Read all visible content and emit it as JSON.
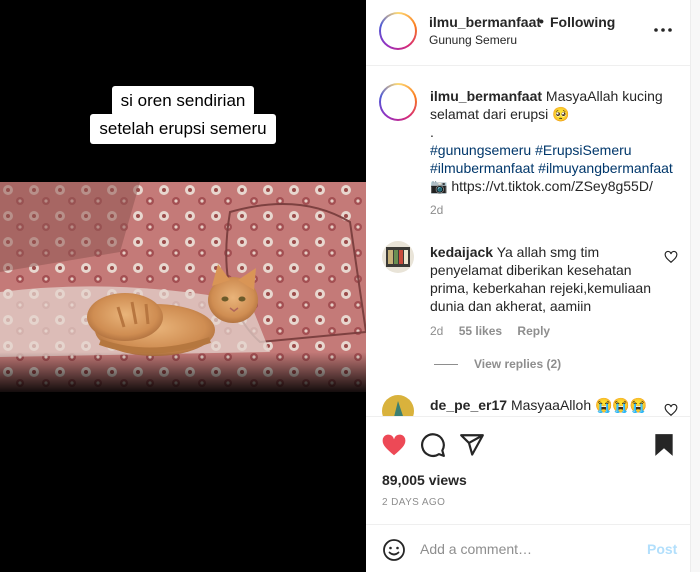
{
  "media": {
    "overlay_line1": "si oren sendirian",
    "overlay_line2": "setelah erupsi semeru"
  },
  "header": {
    "username": "ilmu_bermanfaat",
    "separator": "•",
    "follow_status": "Following",
    "location": "Gunung Semeru"
  },
  "caption": {
    "username": "ilmu_bermanfaat",
    "text": " MasyaAllah kucing selamat dari erupsi 🥺",
    "dot": ".",
    "hashtags": [
      "#gunungsemeru",
      "#ErupsiSemeru",
      "#ilmubermanfaat",
      "#ilmuyangbermanfaat"
    ],
    "link": "📷 https://vt.tiktok.com/ZSey8g55D/",
    "time": "2d"
  },
  "comments": [
    {
      "username": "kedaijack",
      "text": " Ya allah smg tim penyelamat diberikan kesehatan prima, keberkahan rejeki,kemuliaan dunia dan akherat, aamiin",
      "time": "2d",
      "likes": "55 likes",
      "reply": "Reply",
      "view_replies": "View replies (2)"
    },
    {
      "username": "de_pe_er17",
      "text": " MasyaaAlloh 😭😭😭"
    }
  ],
  "stats": {
    "views": "89,005 views",
    "posted": "2 DAYS AGO"
  },
  "add_comment": {
    "placeholder": "Add a comment…",
    "post_label": "Post"
  },
  "colors": {
    "like_red": "#ed4956",
    "link_blue": "#00376b",
    "post_disabled": "#b2dffc"
  },
  "icons": {
    "more": "more-options-icon",
    "like": "heart-filled-icon",
    "comment": "comment-bubble-icon",
    "share": "paper-plane-icon",
    "save": "bookmark-filled-icon",
    "emoji": "emoji-smiley-icon"
  }
}
